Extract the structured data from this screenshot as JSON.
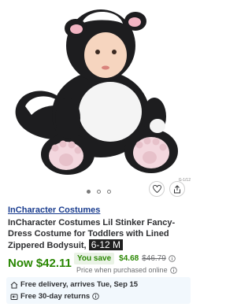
{
  "product": {
    "image_alt": "Baby in skunk costume",
    "image_code": "G-1/12",
    "carousel": {
      "count": 3,
      "active": 0
    },
    "brand": "InCharacter Costumes",
    "title_text": "InCharacter Costumes Lil Stinker Fancy-Dress Costume for Toddlers with Lined Zippered Bodysuit,",
    "size_highlight": "6-12 M"
  },
  "pricing": {
    "now_price": "Now $42.11",
    "save_label": "You save",
    "save_amount": "$4.68",
    "was_price": "$46.79",
    "online_note": "Price when purchased online"
  },
  "fulfillment": {
    "delivery": "Free delivery, arrives Tue, Sep 15",
    "returns": "Free 30-day returns"
  },
  "icons": {
    "heart": "heart-icon",
    "share": "share-icon",
    "info": "info-icon",
    "home": "home-icon",
    "returns": "returns-icon"
  },
  "colors": {
    "brand_link": "#1a3d8f",
    "price_green": "#2a8703",
    "fulfillment_bg": "#f2f8fd"
  }
}
